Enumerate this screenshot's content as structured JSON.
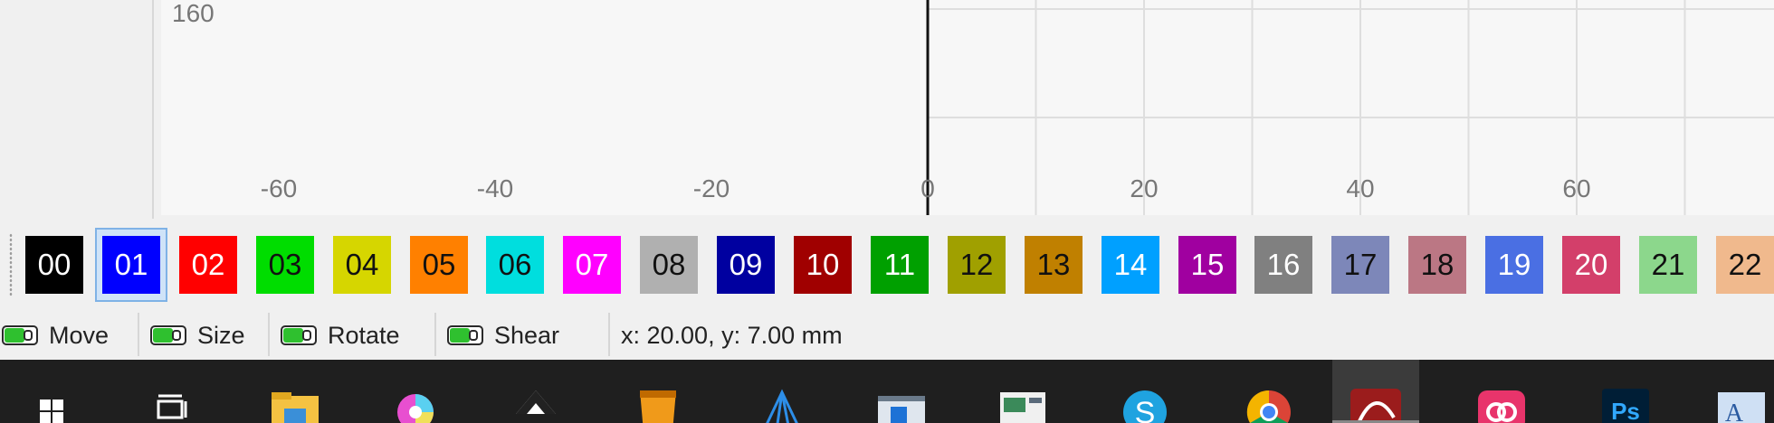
{
  "ruler": {
    "y_label": "160",
    "x_ticks": [
      "-60",
      "-40",
      "-20",
      "0",
      "20",
      "40",
      "60"
    ]
  },
  "layers": [
    {
      "label": "00",
      "color": "#000000",
      "text_color": "#ffffff"
    },
    {
      "label": "01",
      "color": "#0000ff",
      "text_color": "#ffffff",
      "selected": true
    },
    {
      "label": "02",
      "color": "#ff0000",
      "text_color": "#ffffff"
    },
    {
      "label": "03",
      "color": "#00dd00",
      "text_color": "#111111"
    },
    {
      "label": "04",
      "color": "#d6d600",
      "text_color": "#111111"
    },
    {
      "label": "05",
      "color": "#ff8000",
      "text_color": "#111111"
    },
    {
      "label": "06",
      "color": "#00dede",
      "text_color": "#111111"
    },
    {
      "label": "07",
      "color": "#ff00ff",
      "text_color": "#ffffff"
    },
    {
      "label": "08",
      "color": "#b0b0b0",
      "text_color": "#111111"
    },
    {
      "label": "09",
      "color": "#0000a0",
      "text_color": "#ffffff"
    },
    {
      "label": "10",
      "color": "#a00000",
      "text_color": "#ffffff"
    },
    {
      "label": "11",
      "color": "#00a000",
      "text_color": "#ffffff"
    },
    {
      "label": "12",
      "color": "#a0a000",
      "text_color": "#111111"
    },
    {
      "label": "13",
      "color": "#c08000",
      "text_color": "#111111"
    },
    {
      "label": "14",
      "color": "#00a0ff",
      "text_color": "#ffffff"
    },
    {
      "label": "15",
      "color": "#a000a0",
      "text_color": "#ffffff"
    },
    {
      "label": "16",
      "color": "#808080",
      "text_color": "#ffffff"
    },
    {
      "label": "17",
      "color": "#7d87b9",
      "text_color": "#111111"
    },
    {
      "label": "18",
      "color": "#bb7784",
      "text_color": "#111111"
    },
    {
      "label": "19",
      "color": "#4a6fe3",
      "text_color": "#ffffff"
    },
    {
      "label": "20",
      "color": "#d33f6a",
      "text_color": "#ffffff"
    },
    {
      "label": "21",
      "color": "#8cd78c",
      "text_color": "#111111"
    },
    {
      "label": "22",
      "color": "#f0b98d",
      "text_color": "#111111"
    }
  ],
  "tools": {
    "move": "Move",
    "size": "Size",
    "rotate": "Rotate",
    "shear": "Shear"
  },
  "status": {
    "coords": "x: 20.00, y: 7.00 mm"
  },
  "taskbar": [
    {
      "icon": "windows-start-icon"
    },
    {
      "icon": "task-view-icon"
    },
    {
      "icon": "file-explorer-icon"
    },
    {
      "icon": "color-wheel-app-icon"
    },
    {
      "icon": "inkscape-icon"
    },
    {
      "icon": "orange-bin-app-icon"
    },
    {
      "icon": "blue-pyramid-app-icon"
    },
    {
      "icon": "window-app-icon"
    },
    {
      "icon": "dashboard-app-icon"
    },
    {
      "icon": "skype-icon"
    },
    {
      "icon": "chrome-icon"
    },
    {
      "icon": "red-laser-app-icon",
      "active": true
    },
    {
      "icon": "creative-cloud-icon"
    },
    {
      "icon": "photoshop-icon",
      "label": "Ps"
    },
    {
      "icon": "font-app-icon",
      "label": "A"
    }
  ]
}
